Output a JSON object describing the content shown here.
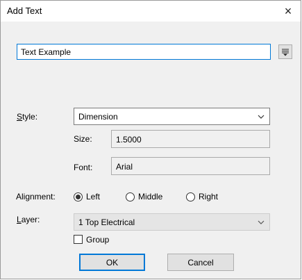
{
  "window": {
    "title": "Add Text",
    "close_glyph": "×"
  },
  "text_field": {
    "value": "Text Example"
  },
  "format_button": {
    "icon": "format-menu-icon"
  },
  "style": {
    "label_prefix": "S",
    "label_rest": "tyle:",
    "value": "Dimension",
    "size_label": "Size:",
    "size_value": "1.5000",
    "font_label": "Font:",
    "font_value": "Arial"
  },
  "alignment": {
    "label": "Alignment:",
    "options": [
      {
        "label": "Left",
        "selected": true
      },
      {
        "label": "Middle",
        "selected": false
      },
      {
        "label": "Right",
        "selected": false
      }
    ]
  },
  "layer": {
    "label_prefix": "L",
    "label_rest": "ayer:",
    "value": "1 Top Electrical"
  },
  "group": {
    "label": "Group",
    "checked": false
  },
  "buttons": {
    "ok": "OK",
    "cancel": "Cancel"
  },
  "colors": {
    "accent": "#0078d7",
    "dialog_bg": "#f0f0f0"
  }
}
